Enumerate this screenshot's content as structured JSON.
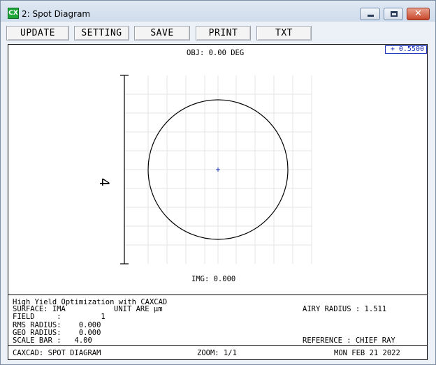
{
  "window": {
    "title": "2: Spot Diagram",
    "app_icon_text": "CX",
    "controls": {
      "minimize": "minimize-icon",
      "maximize": "maximize-icon",
      "close": "close-icon"
    }
  },
  "toolbar": {
    "buttons": [
      "UPDATE",
      "SETTING",
      "SAVE",
      "PRINT",
      "TXT"
    ]
  },
  "plot": {
    "scale_value": "+ 0.5500",
    "obj_label": "OBJ: 0.00 DEG",
    "img_label": "IMG: 0.000",
    "scale_bar_label": "4",
    "ray_color": "#1a2fb8",
    "scale_color": "#1a2fb8"
  },
  "info": {
    "heading": "High Yield Optimization with CAXCAD",
    "surface": "SURFACE: IMA",
    "unit": "UNIT ARE µm",
    "field": "FIELD     :         1",
    "rms": "RMS RADIUS:    0.000",
    "geo": "GEO RADIUS:    0.000",
    "scale_bar": "SCALE BAR :   4.00",
    "airy": "AIRY RADIUS : 1.511",
    "reference": "REFERENCE : CHIEF RAY"
  },
  "footer": {
    "left": "CAXCAD: SPOT DIAGRAM",
    "zoom": "ZOOM: 1/1",
    "date": "MON FEB 21 2022"
  }
}
